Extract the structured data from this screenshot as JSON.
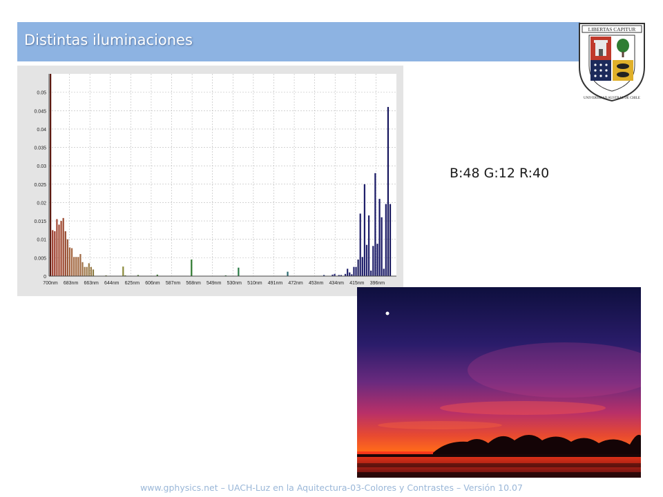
{
  "slide": {
    "title": "Distintas iluminaciones",
    "rgb_readout": "B:48 G:12 R:40",
    "footer": "www.gphysics.net – UACH-Luz en la Aquitectura-03-Colores y Contrastes – Versión 10.07"
  },
  "logo": {
    "motto": "LIBERTAS CAPITUR",
    "ring_text": "UNIVERSIDAD AUSTRAL DE CHILE"
  },
  "colors": {
    "title_bar": "#8db3e2",
    "footer_text": "#9ab7d8"
  },
  "chart_data": {
    "type": "bar",
    "title": "",
    "xlabel": "",
    "ylabel": "",
    "ylim": [
      0,
      0.055
    ],
    "yticks": [
      "0",
      "0.005",
      "0.01",
      "0.015",
      "0.02",
      "0.025",
      "0.03",
      "0.035",
      "0.04",
      "0.045",
      "0.05"
    ],
    "xtick_labels": [
      "700nm",
      "683nm",
      "663nm",
      "644nm",
      "625nm",
      "606nm",
      "587nm",
      "568nm",
      "549nm",
      "530nm",
      "510nm",
      "491nm",
      "472nm",
      "453nm",
      "434nm",
      "415nm",
      "396nm"
    ],
    "grid": true,
    "wavelength_range_nm": [
      700,
      380
    ],
    "values": [
      0.055,
      0.0125,
      0.0122,
      0.0155,
      0.014,
      0.015,
      0.0158,
      0.0122,
      0.01,
      0.0078,
      0.0076,
      0.0052,
      0.0052,
      0.0052,
      0.006,
      0.0038,
      0.0025,
      0.0025,
      0.0035,
      0.0025,
      0.0018,
      0.0,
      0.0,
      0.0,
      0.0,
      0.0,
      0.0002,
      0.0,
      0.0,
      0.0,
      0.0,
      0.0,
      0.0,
      0.0,
      0.0026,
      0.0002,
      0.0,
      0.0,
      0.0,
      0.0,
      0.0,
      0.0003,
      0.0,
      0.0,
      0.0,
      0.0,
      0.0,
      0.0,
      0.0,
      0.0,
      0.0004,
      0.0,
      0.0,
      0.0,
      0.0,
      0.0,
      0.0,
      0.0,
      0.0,
      0.0,
      0.0,
      0.0,
      0.0,
      0.0,
      0.0,
      0.0,
      0.0045,
      0.0,
      0.0,
      0.0,
      0.0,
      0.0,
      0.0,
      0.0,
      0.0,
      0.0,
      0.0,
      0.0,
      0.0,
      0.0,
      0.0,
      0.0,
      0.0002,
      0.0,
      0.0,
      0.0,
      0.0,
      0.0,
      0.0023,
      0.0,
      0.0,
      0.0,
      0.0,
      0.0,
      0.0,
      0.0,
      0.0,
      0.0,
      0.0,
      0.0,
      0.0,
      0.0,
      0.0,
      0.0,
      0.0,
      0.0,
      0.0,
      0.0,
      0.0,
      0.0,
      0.0,
      0.0012,
      0.0,
      0.0,
      0.0,
      0.0,
      0.0,
      0.0,
      0.0,
      0.0,
      0.0,
      0.0,
      0.0,
      0.0,
      0.0,
      0.0,
      0.0,
      0.0,
      0.0003,
      0.0,
      0.0,
      0.0,
      0.0004,
      0.0006,
      0.0,
      0.0003,
      0.0003,
      0.0,
      0.0006,
      0.002,
      0.001,
      0.0005,
      0.0025,
      0.0025,
      0.0045,
      0.017,
      0.0052,
      0.025,
      0.0085,
      0.0165,
      0.0015,
      0.0082,
      0.028,
      0.0088,
      0.021,
      0.016,
      0.002,
      0.0196,
      0.046,
      0.0196
    ],
    "colors": [
      "#5c1a10",
      "#9c3b2c",
      "#9c3b2c",
      "#a34a35",
      "#a34a35",
      "#a04830",
      "#9c4a32",
      "#96482e",
      "#9a5536",
      "#9f5e3a",
      "#a36540",
      "#a36a42",
      "#a36a42",
      "#a36a42",
      "#a06a44",
      "#a07248",
      "#a07a4c",
      "#a07a4c",
      "#9a7c48",
      "#9a7c48",
      "#8a7a40",
      "#888888",
      "#888888",
      "#888888",
      "#888888",
      "#888888",
      "#6f7a32",
      "#888888",
      "#888888",
      "#888888",
      "#888888",
      "#888888",
      "#888888",
      "#888888",
      "#8a8a3a",
      "#5a7a30",
      "#888888",
      "#888888",
      "#888888",
      "#888888",
      "#888888",
      "#4f7a35",
      "#888888",
      "#888888",
      "#888888",
      "#888888",
      "#888888",
      "#888888",
      "#888888",
      "#888888",
      "#3f7a35",
      "#888888",
      "#888888",
      "#888888",
      "#888888",
      "#888888",
      "#888888",
      "#888888",
      "#888888",
      "#888888",
      "#888888",
      "#888888",
      "#888888",
      "#888888",
      "#888888",
      "#888888",
      "#2f7a30",
      "#888888",
      "#888888",
      "#888888",
      "#888888",
      "#888888",
      "#888888",
      "#888888",
      "#888888",
      "#888888",
      "#888888",
      "#888888",
      "#888888",
      "#888888",
      "#888888",
      "#888888",
      "#2f7a40",
      "#888888",
      "#888888",
      "#888888",
      "#888888",
      "#888888",
      "#2a7a45",
      "#888888",
      "#888888",
      "#888888",
      "#888888",
      "#888888",
      "#888888",
      "#888888",
      "#888888",
      "#888888",
      "#888888",
      "#888888",
      "#888888",
      "#888888",
      "#888888",
      "#888888",
      "#888888",
      "#888888",
      "#888888",
      "#888888",
      "#888888",
      "#888888",
      "#888888",
      "#2a6a70",
      "#888888",
      "#888888",
      "#888888",
      "#888888",
      "#888888",
      "#888888",
      "#888888",
      "#888888",
      "#888888",
      "#888888",
      "#888888",
      "#888888",
      "#888888",
      "#888888",
      "#888888",
      "#888888",
      "#2a3a7a",
      "#888888",
      "#888888",
      "#888888",
      "#2a2a7a",
      "#2a2a7a",
      "#888888",
      "#2a2a7a",
      "#2a2a7a",
      "#888888",
      "#24246e",
      "#24246e",
      "#24246e",
      "#24246e",
      "#24246e",
      "#24246e",
      "#20205e",
      "#1e1e6a",
      "#1e1e6a",
      "#1e1e6a",
      "#1e1e6a",
      "#1e1e6a",
      "#1e1e6a",
      "#1e1e6a",
      "#1a1a66",
      "#1a1a66",
      "#1a1a66",
      "#1a1a66",
      "#1a1a66",
      "#1a1a66",
      "#16165e",
      "#16165e"
    ]
  }
}
